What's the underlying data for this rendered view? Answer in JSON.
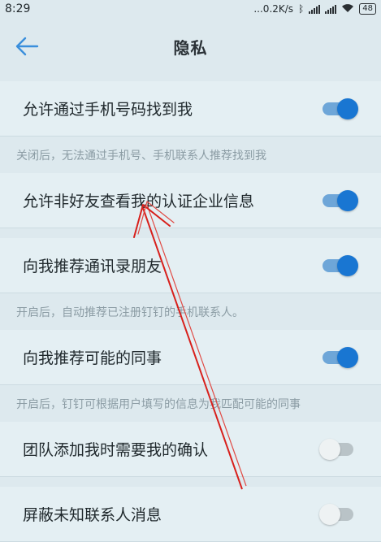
{
  "status_bar": {
    "time": "8:29",
    "network_speed": "...0.2K/s",
    "battery": "48"
  },
  "header": {
    "title": "隐私",
    "back_icon": "arrow-left-icon",
    "accent": "#3a8fdc"
  },
  "settings": [
    {
      "label": "允许通过手机号码找到我",
      "enabled": true,
      "note": "关闭后，无法通过手机号、手机联系人推荐找到我"
    },
    {
      "label": "允许非好友查看我的认证企业信息",
      "enabled": true,
      "note": ""
    },
    {
      "label": "向我推荐通讯录朋友",
      "enabled": true,
      "note": "开启后，自动推荐已注册钉钉的手机联系人。"
    },
    {
      "label": "向我推荐可能的同事",
      "enabled": true,
      "note": "开启后，钉钉可根据用户填写的信息为我匹配可能的同事"
    },
    {
      "label": "团队添加我时需要我的确认",
      "enabled": false,
      "note": ""
    },
    {
      "label": "屏蔽未知联系人消息",
      "enabled": false,
      "note": ""
    }
  ],
  "colors": {
    "toggle_on": "#1976d2",
    "toggle_off": "#eef2f3",
    "annotation_arrow": "#d8201c"
  }
}
